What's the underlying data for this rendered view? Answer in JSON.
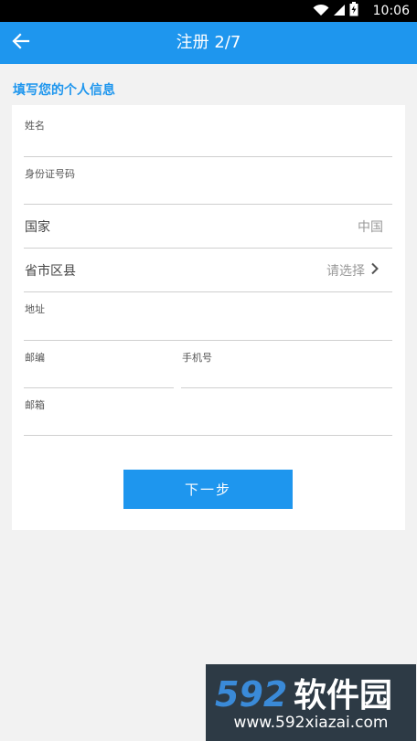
{
  "status_bar": {
    "time": "10:06",
    "icons": [
      "wifi-icon",
      "signal-icon",
      "battery-icon"
    ]
  },
  "app_bar": {
    "title": "注册 2/7",
    "back_icon": "arrow-left-icon"
  },
  "form": {
    "section_heading": "填写您的个人信息",
    "name": {
      "label": "姓名",
      "value": ""
    },
    "id_number": {
      "label": "身份证号码",
      "value": ""
    },
    "country": {
      "label": "国家",
      "value": "中国"
    },
    "region": {
      "label": "省市区县",
      "value": "请选择",
      "icon": "chevron-right-icon"
    },
    "address": {
      "label": "地址",
      "value": ""
    },
    "postcode": {
      "label": "邮编",
      "value": ""
    },
    "phone": {
      "label": "手机号",
      "value": ""
    },
    "email": {
      "label": "邮箱",
      "value": ""
    },
    "next_button": "下一步"
  },
  "watermark": {
    "logo_text": "592软件园",
    "url": "www.592xiazai.com"
  },
  "colors": {
    "primary": "#1e96ee",
    "background": "#f2f2f2",
    "card": "#ffffff",
    "divider": "#cfcfcf"
  }
}
